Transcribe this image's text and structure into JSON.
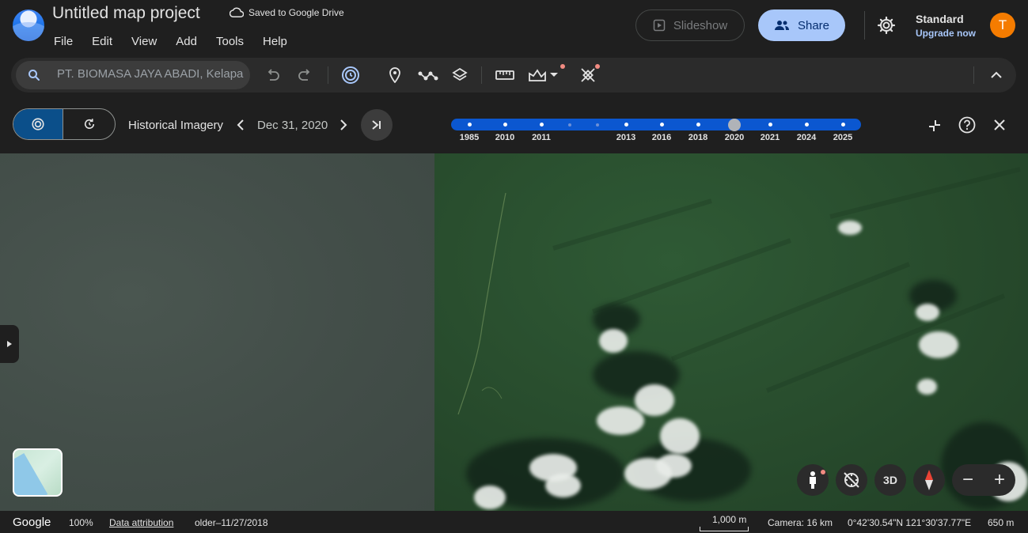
{
  "app": {
    "title": "Untitled map project",
    "saved_status": "Saved to Google Drive",
    "menu": [
      "File",
      "Edit",
      "View",
      "Add",
      "Tools",
      "Help"
    ],
    "slideshow_label": "Slideshow",
    "share_label": "Share",
    "plan_label": "Standard",
    "upgrade_label": "Upgrade now",
    "avatar_initial": "T"
  },
  "toolbar": {
    "search_value": "PT. BIOMASA JAYA ABADI, Kelapa"
  },
  "historical": {
    "label": "Historical Imagery",
    "date": "Dec 31, 2020",
    "years": [
      "1985",
      "2010",
      "2011",
      "2013",
      "2016",
      "2018",
      "2020",
      "2021",
      "2024",
      "2025"
    ],
    "selected_year": "2020"
  },
  "map_controls": {
    "view_3d_label": "3D",
    "zoom_out_label": "−",
    "zoom_in_label": "+"
  },
  "status_bar": {
    "google": "Google",
    "zoom_percent": "100%",
    "data_attribution": "Data attribution",
    "imagery_date": "older–11/27/2018",
    "scale": "1,000 m",
    "camera": "Camera: 16 km",
    "coordinates": "0°42'30.54\"N 121°30'37.77\"E",
    "elevation": "650 m"
  },
  "colors": {
    "accent": "#a8c7fa",
    "timeline": "#0b57d0",
    "avatar": "#f57c00"
  }
}
